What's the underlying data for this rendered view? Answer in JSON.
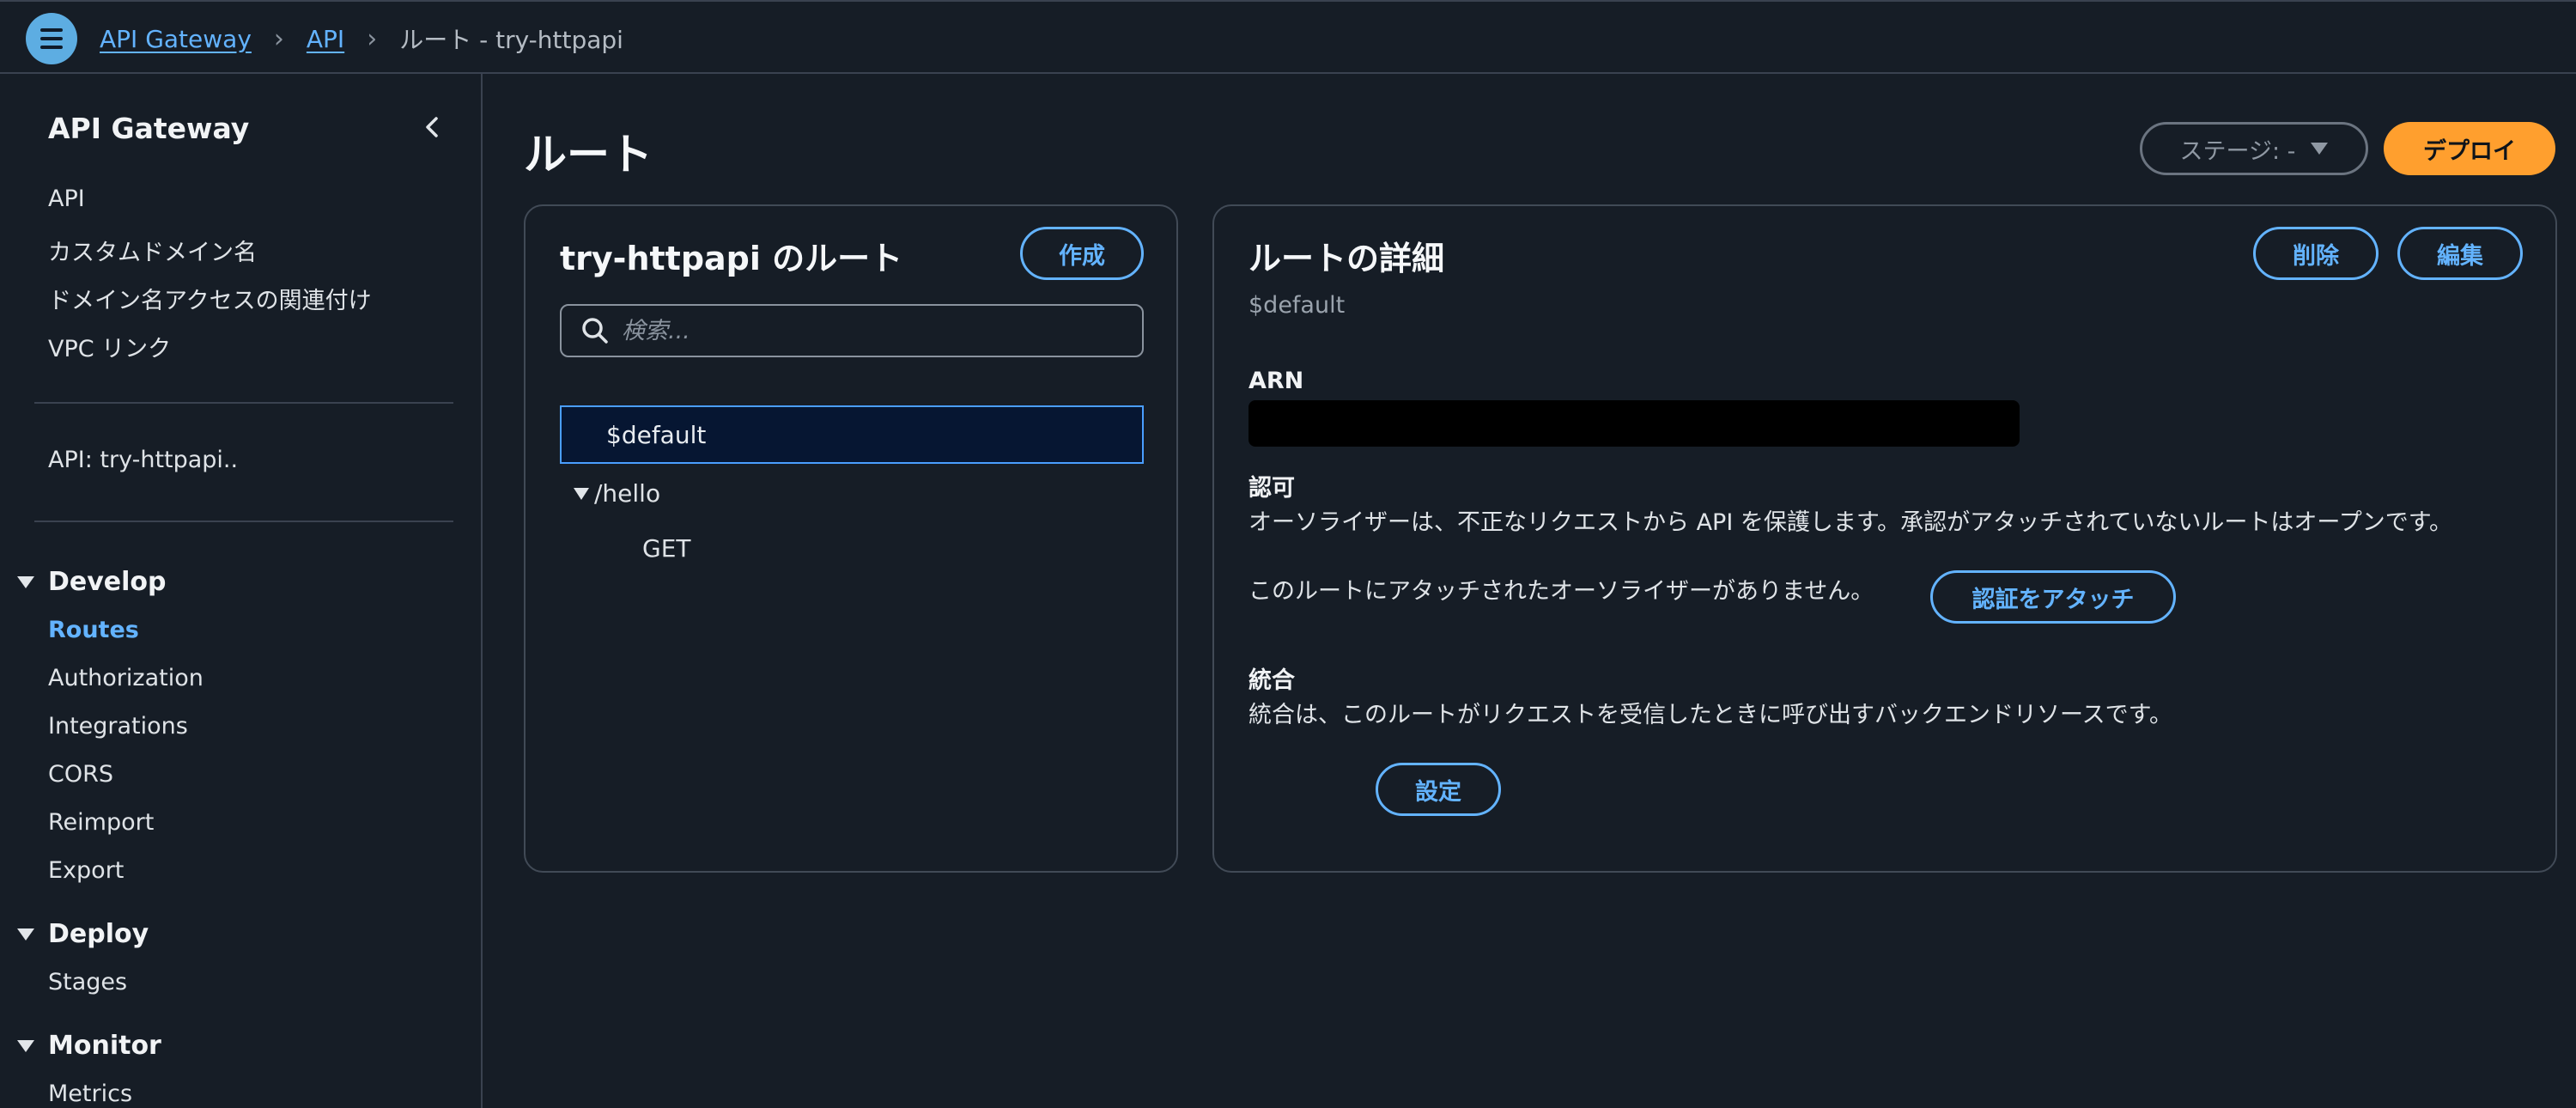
{
  "breadcrumb": {
    "items": [
      "API Gateway",
      "API"
    ],
    "current": "ルート - try-httpapi"
  },
  "sidebar": {
    "title": "API Gateway",
    "items_top": [
      "API",
      "カスタムドメイン名",
      "ドメイン名アクセスの関連付け",
      "VPC リンク"
    ],
    "api_name": "API: try-httpapi..",
    "sections": {
      "develop": {
        "label": "Develop",
        "items": [
          "Routes",
          "Authorization",
          "Integrations",
          "CORS",
          "Reimport",
          "Export"
        ]
      },
      "deploy": {
        "label": "Deploy",
        "items": [
          "Stages"
        ]
      },
      "monitor": {
        "label": "Monitor",
        "items": [
          "Metrics"
        ]
      }
    }
  },
  "main": {
    "title": "ルート",
    "stage_label": "ステージ: -",
    "deploy_label": "デプロイ"
  },
  "routes_panel": {
    "heading": "try-httpapi のルート",
    "create_label": "作成",
    "search_placeholder": "検索...",
    "selected_route": "$default",
    "group": "/hello",
    "method": "GET"
  },
  "detail_panel": {
    "heading": "ルートの詳細",
    "subtitle": "$default",
    "delete_label": "削除",
    "edit_label": "編集",
    "arn_label": "ARN",
    "auth_label": "認可",
    "auth_desc": "オーソライザーは、不正なリクエストから API を保護します。承認がアタッチされていないルートはオープンです。",
    "auth_none": "このルートにアタッチされたオーソライザーがありません。",
    "attach_auth_label": "認証をアタッチ",
    "integration_label": "統合",
    "integration_desc": "統合は、このルートがリクエストを受信したときに呼び出すバックエンドリソースです。",
    "configure_label": "設定"
  },
  "colors": {
    "background": "#161d26",
    "accent": "#63b3ff",
    "deploy": "#ff9f2e"
  }
}
